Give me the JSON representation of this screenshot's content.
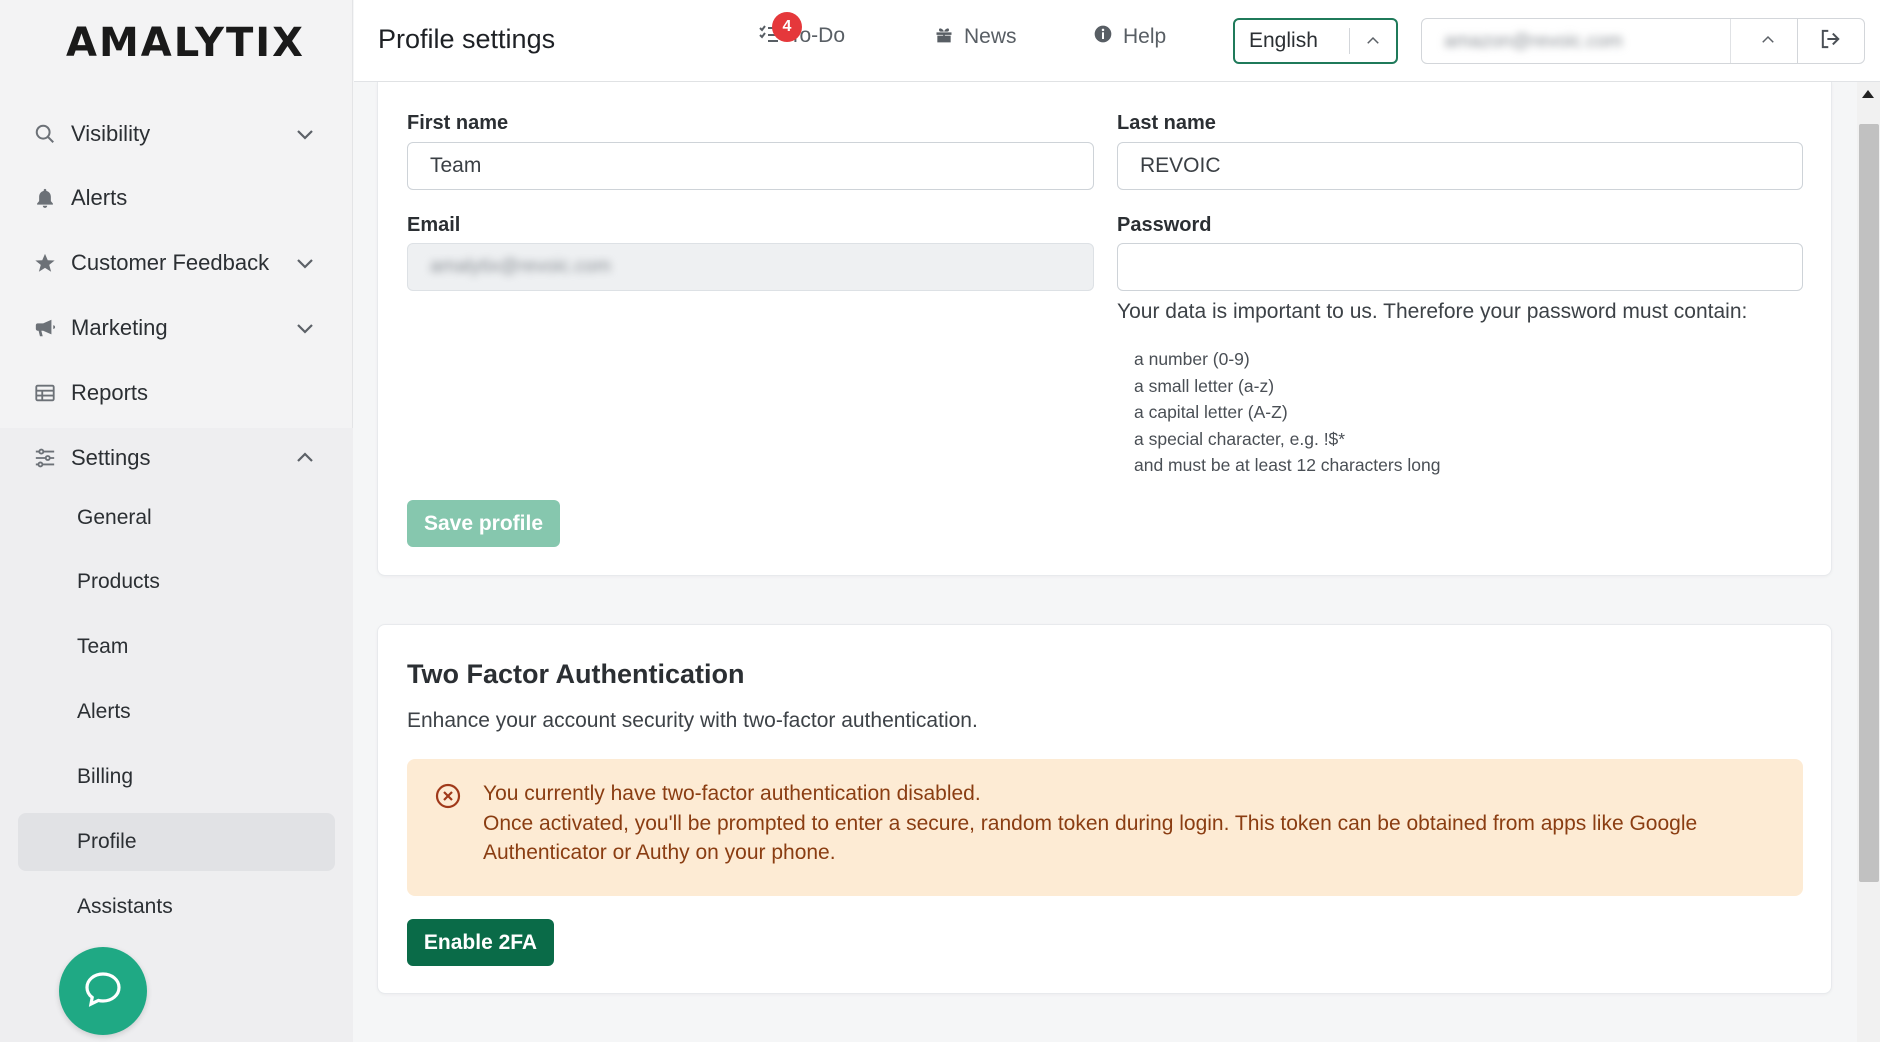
{
  "app": {
    "logo": "AMALYTIX"
  },
  "sidebar": {
    "items": [
      {
        "label": "Visibility",
        "icon": "search-icon",
        "has_chevron": true
      },
      {
        "label": "Alerts",
        "icon": "bell-icon",
        "has_chevron": false
      },
      {
        "label": "Customer Feedback",
        "icon": "star-icon",
        "has_chevron": true
      },
      {
        "label": "Marketing",
        "icon": "megaphone-icon",
        "has_chevron": true
      },
      {
        "label": "Reports",
        "icon": "table-icon",
        "has_chevron": false
      },
      {
        "label": "Settings",
        "icon": "sliders-icon",
        "expanded": true
      }
    ],
    "settings_subitems": [
      {
        "label": "General"
      },
      {
        "label": "Products"
      },
      {
        "label": "Team"
      },
      {
        "label": "Alerts"
      },
      {
        "label": "Billing"
      },
      {
        "label": "Profile",
        "active": true
      },
      {
        "label": "Assistants"
      }
    ]
  },
  "header": {
    "title": "Profile settings",
    "todo_label": "To-Do",
    "todo_count": "4",
    "news_label": "News",
    "help_label": "Help",
    "language": "English",
    "account_email": "amazon@revoic.com"
  },
  "profile_form": {
    "first_name_label": "First name",
    "first_name_value": "Team",
    "last_name_label": "Last name",
    "last_name_value": "REVOIC",
    "email_label": "Email",
    "email_value": "amalytix@revoic.com",
    "password_label": "Password",
    "password_value": "",
    "password_hint": "Your data is important to us. Therefore your password must contain:",
    "password_rules": [
      "a number (0-9)",
      "a small letter (a-z)",
      "a capital letter (A-Z)",
      "a special character, e.g. !$*",
      "and must be at least 12 characters long"
    ],
    "save_label": "Save profile"
  },
  "two_factor": {
    "title": "Two Factor Authentication",
    "subtitle": "Enhance your account security with two-factor authentication.",
    "alert_line1": "You currently have two-factor authentication disabled.",
    "alert_line2": "Once activated, you'll be prompted to enter a secure, random token during login. This token can be obtained from apps like Google Authenticator or Authy on your phone.",
    "enable_label": "Enable 2FA"
  },
  "colors": {
    "accent": "#0a6b48",
    "accent_light": "#86c7ae",
    "alert_bg": "#fdebd4",
    "alert_text": "#8a3d12",
    "badge": "#e5383b",
    "chat": "#1fa984"
  }
}
